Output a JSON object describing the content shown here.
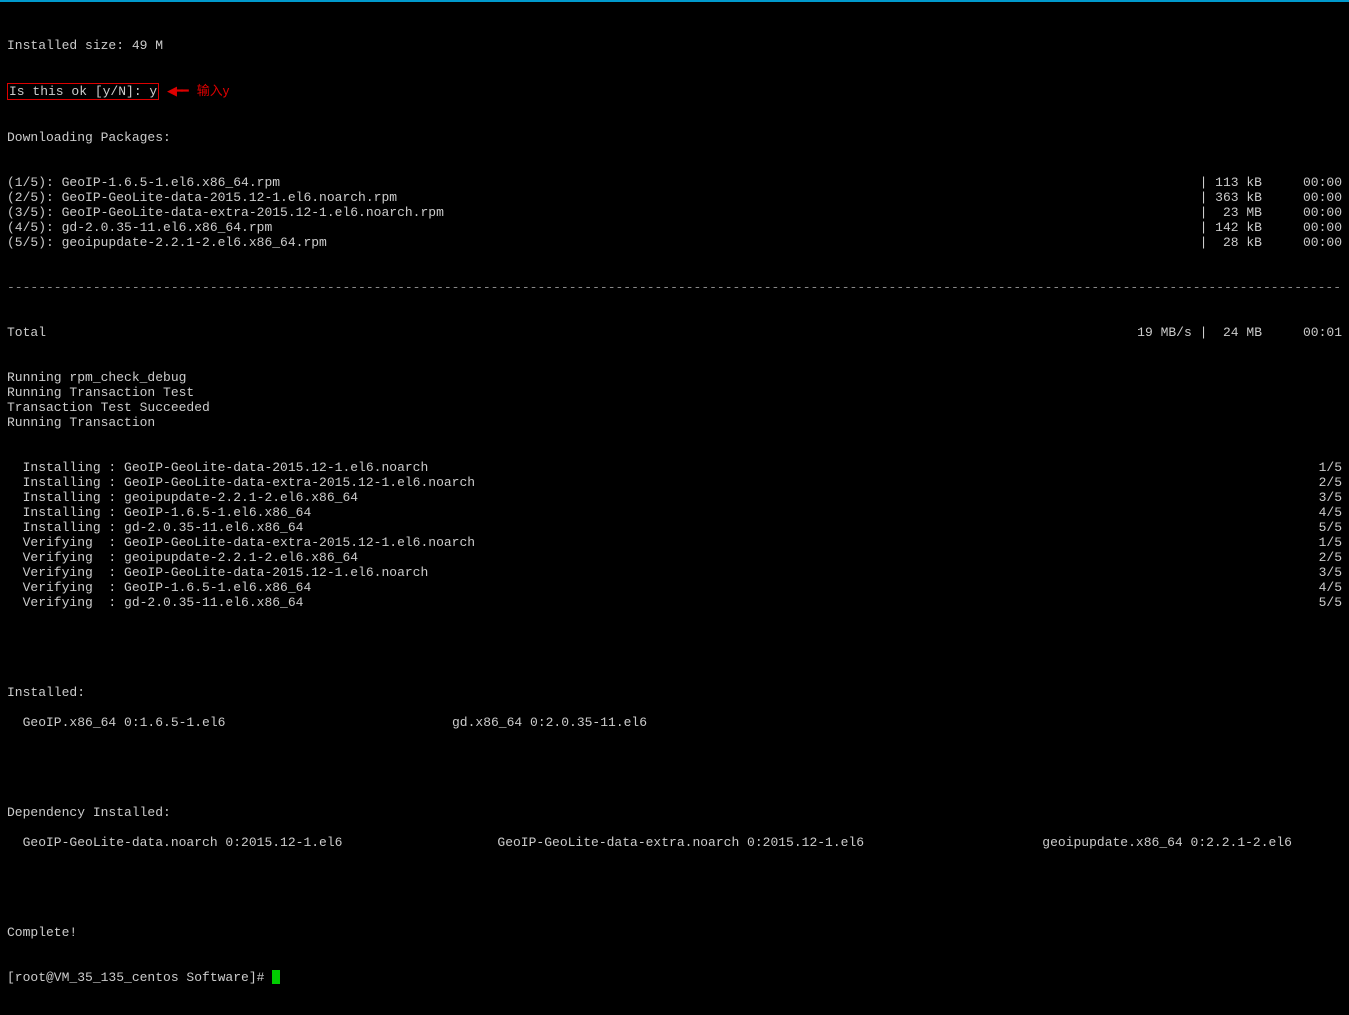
{
  "installed_size_label": "Installed size: 49 M",
  "prompt_text": "Is this ok [y/N]: y",
  "annotation": "输入y",
  "downloading_label": "Downloading Packages:",
  "downloads": [
    {
      "line": "(1/5): GeoIP-1.6.5-1.el6.x86_64.rpm",
      "size": "| 113 kB",
      "time": "00:00"
    },
    {
      "line": "(2/5): GeoIP-GeoLite-data-2015.12-1.el6.noarch.rpm",
      "size": "| 363 kB",
      "time": "00:00"
    },
    {
      "line": "(3/5): GeoIP-GeoLite-data-extra-2015.12-1.el6.noarch.rpm",
      "size": "|  23 MB",
      "time": "00:00"
    },
    {
      "line": "(4/5): gd-2.0.35-11.el6.x86_64.rpm",
      "size": "| 142 kB",
      "time": "00:00"
    },
    {
      "line": "(5/5): geoipupdate-2.2.1-2.el6.x86_64.rpm",
      "size": "|  28 kB",
      "time": "00:00"
    }
  ],
  "total_label": "Total",
  "total_speed": "19 MB/s |  24 MB",
  "total_time": "00:01",
  "status_lines": [
    "Running rpm_check_debug",
    "Running Transaction Test",
    "Transaction Test Succeeded",
    "Running Transaction"
  ],
  "transactions": [
    {
      "l": "  Installing : GeoIP-GeoLite-data-2015.12-1.el6.noarch",
      "r": "1/5"
    },
    {
      "l": "  Installing : GeoIP-GeoLite-data-extra-2015.12-1.el6.noarch",
      "r": "2/5"
    },
    {
      "l": "  Installing : geoipupdate-2.2.1-2.el6.x86_64",
      "r": "3/5"
    },
    {
      "l": "  Installing : GeoIP-1.6.5-1.el6.x86_64",
      "r": "4/5"
    },
    {
      "l": "  Installing : gd-2.0.35-11.el6.x86_64",
      "r": "5/5"
    },
    {
      "l": "  Verifying  : GeoIP-GeoLite-data-extra-2015.12-1.el6.noarch",
      "r": "1/5"
    },
    {
      "l": "  Verifying  : geoipupdate-2.2.1-2.el6.x86_64",
      "r": "2/5"
    },
    {
      "l": "  Verifying  : GeoIP-GeoLite-data-2015.12-1.el6.noarch",
      "r": "3/5"
    },
    {
      "l": "  Verifying  : GeoIP-1.6.5-1.el6.x86_64",
      "r": "4/5"
    },
    {
      "l": "  Verifying  : gd-2.0.35-11.el6.x86_64",
      "r": "5/5"
    }
  ],
  "installed_hdr": "Installed:",
  "installed_col1": "  GeoIP.x86_64 0:1.6.5-1.el6",
  "installed_col2": "gd.x86_64 0:2.0.35-11.el6",
  "dep_hdr": "Dependency Installed:",
  "dep_col1": "  GeoIP-GeoLite-data.noarch 0:2015.12-1.el6",
  "dep_col2": "GeoIP-GeoLite-data-extra.noarch 0:2015.12-1.el6",
  "dep_col3": "geoipupdate.x86_64 0:2.2.1-2.el6",
  "complete": "Complete!",
  "shell_prompt": "[root@VM_35_135_centos Software]# "
}
